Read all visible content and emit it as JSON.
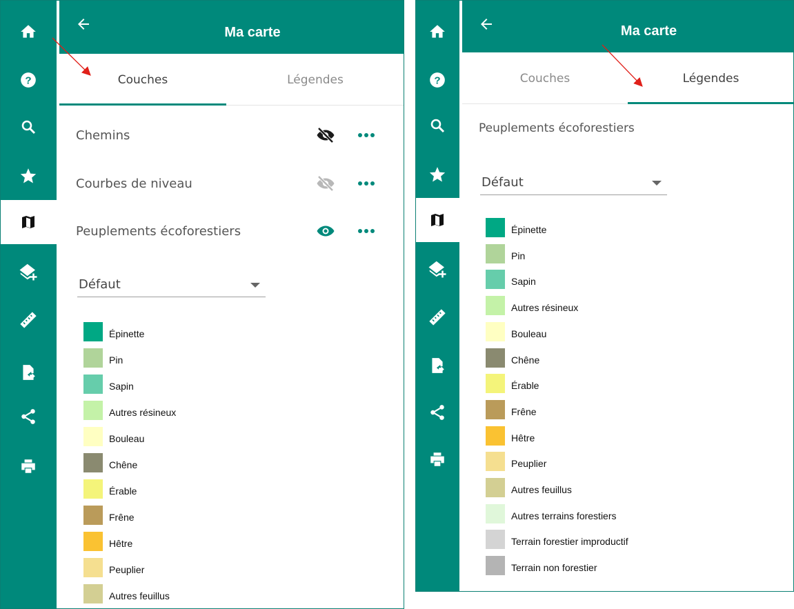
{
  "header": {
    "title": "Ma carte"
  },
  "tabs": [
    {
      "label": "Couches"
    },
    {
      "label": "Légendes"
    }
  ],
  "rail": [
    {
      "icon": "home-icon"
    },
    {
      "icon": "help-icon"
    },
    {
      "icon": "search-icon"
    },
    {
      "icon": "star-icon"
    },
    {
      "icon": "map-icon"
    },
    {
      "icon": "add-layer-icon"
    },
    {
      "icon": "ruler-icon"
    },
    {
      "icon": "export-file-icon"
    },
    {
      "icon": "share-icon"
    },
    {
      "icon": "print-icon"
    }
  ],
  "layers": [
    {
      "name": "Chemins",
      "visibility": "hidden"
    },
    {
      "name": "Courbes de niveau",
      "visibility": "hidden-dimmed"
    },
    {
      "name": "Peuplements écoforestiers",
      "visibility": "visible"
    }
  ],
  "legend_section_title": "Peuplements écoforestiers",
  "style_select": {
    "value": "Défaut"
  },
  "legend": [
    {
      "label": "Épinette",
      "color": "#00a884"
    },
    {
      "label": "Pin",
      "color": "#b0d49a"
    },
    {
      "label": "Sapin",
      "color": "#66cdab"
    },
    {
      "label": "Autres résineux",
      "color": "#c4f2a8"
    },
    {
      "label": "Bouleau",
      "color": "#ffffc2"
    },
    {
      "label": "Chêne",
      "color": "#8a8a70"
    },
    {
      "label": "Érable",
      "color": "#f4f47a"
    },
    {
      "label": "Frêne",
      "color": "#ba9b5a"
    },
    {
      "label": "Hêtre",
      "color": "#fac232"
    },
    {
      "label": "Peuplier",
      "color": "#f5df90"
    },
    {
      "label": "Autres feuillus",
      "color": "#d3cf93"
    },
    {
      "label": "Autres terrains forestiers",
      "color": "#e0f7da"
    },
    {
      "label": "Terrain forestier improductif",
      "color": "#d4d4d4"
    },
    {
      "label": "Terrain non forestier",
      "color": "#b4b4b4"
    }
  ],
  "colors": {
    "primary": "#00897b",
    "annotation_arrow": "#e0201a"
  }
}
